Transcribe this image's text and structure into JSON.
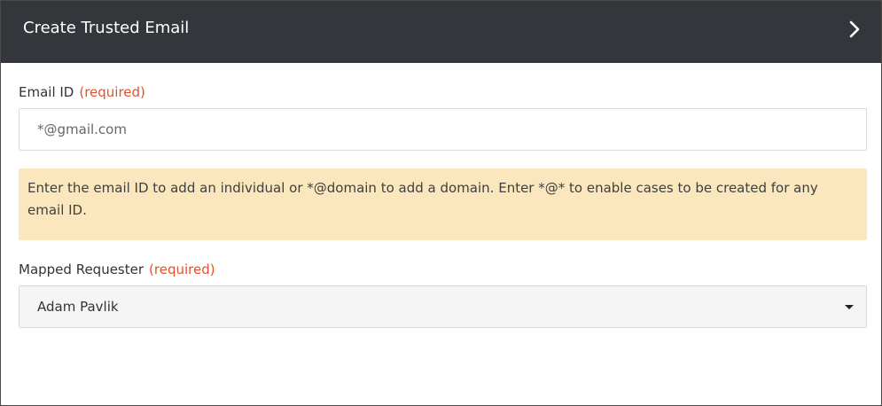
{
  "header": {
    "title": "Create Trusted Email",
    "chevron_icon": "chevron-right-icon"
  },
  "email_field": {
    "label": "Email ID",
    "required_text": "(required)",
    "placeholder": "*@gmail.com",
    "value": ""
  },
  "hint": {
    "text": "Enter the email ID to add an individual or *@domain to add a domain. Enter *@* to enable cases to be created for any email ID."
  },
  "requester_field": {
    "label": "Mapped Requester",
    "required_text": "(required)",
    "selected_value": "Adam Pavlik",
    "caret_icon": "caret-down-icon"
  },
  "colors": {
    "header_bg": "#33373b",
    "required": "#e4512b",
    "hint_bg": "#fbe7bd"
  }
}
